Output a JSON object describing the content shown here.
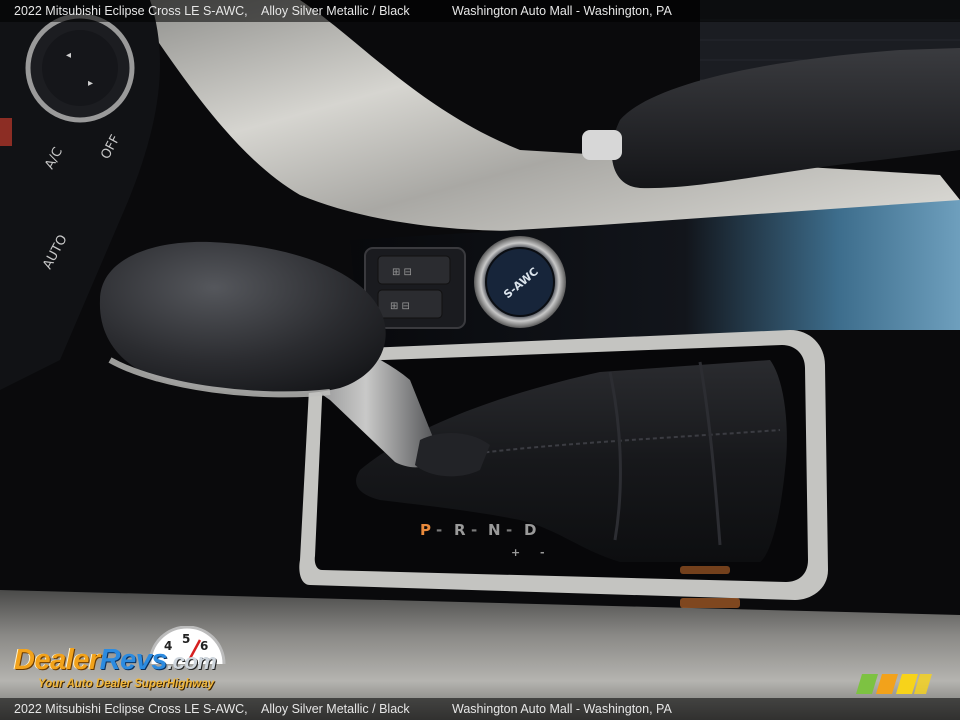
{
  "caption": {
    "vehicle": "2022 Mitsubishi Eclipse Cross LE S-AWC,",
    "separator": "",
    "color": "Alloy Silver Metallic  /  Black",
    "dealer": "Washington Auto Mall - Washington, PA"
  },
  "console": {
    "hvac_labels": [
      "A/C",
      "OFF",
      "AUTO"
    ],
    "gear_labels": [
      "P",
      "R",
      "N",
      "D",
      "+",
      "-"
    ],
    "drive_button": "S-AWC"
  },
  "watermark": {
    "brand_part1": "Dealer",
    "brand_part2": "Revs",
    "brand_part3": ".com",
    "tagline": "Your Auto Dealer SuperHighway",
    "gauge_digits": [
      "4",
      "5",
      "6"
    ]
  },
  "colors": {
    "leather": "#1c1d20",
    "silver_trim": "#b9b9b6",
    "piano_black": "#0c0e12",
    "gear_p_active": "#e98a3c",
    "logo_orange": "#f2a21b",
    "logo_blue": "#2c8be0"
  }
}
